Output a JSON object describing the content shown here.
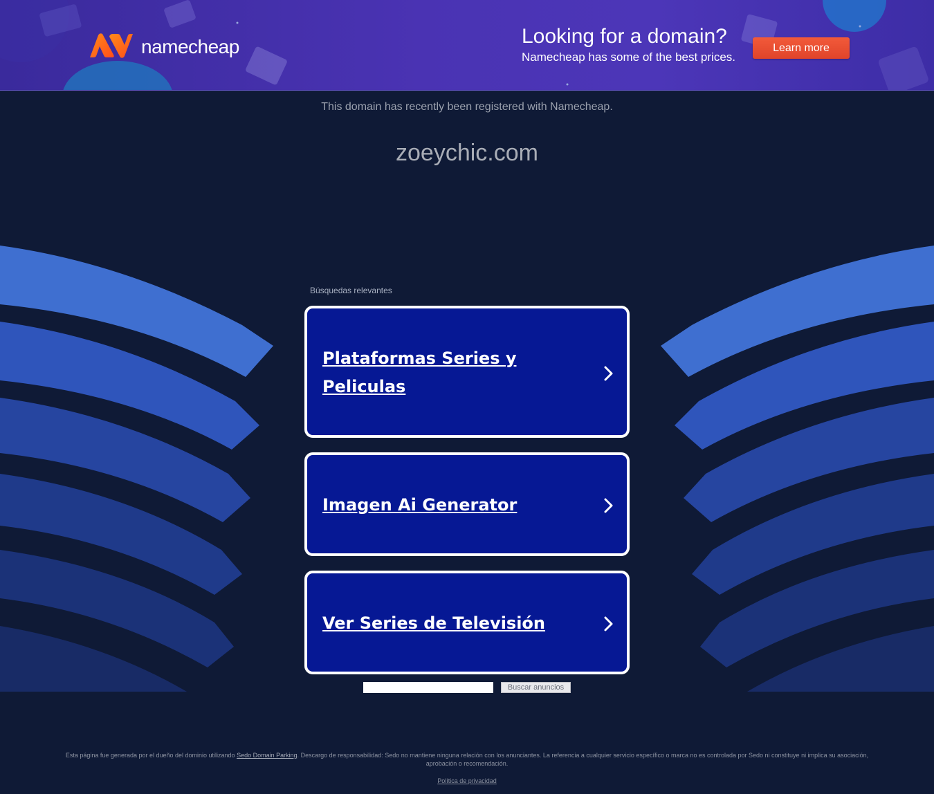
{
  "banner": {
    "brand": "namecheap",
    "headline": "Looking for a domain?",
    "subline": "Namecheap has some of the best prices.",
    "cta_label": "Learn more",
    "colors": {
      "brand_orange": "#ff6a1a",
      "cta_red": "#e8492e",
      "banner_purple": "#4a33b3"
    }
  },
  "header": {
    "registered_notice": "This domain has recently been registered with Namecheap.",
    "domain": "zoeychic.com"
  },
  "related": {
    "title": "Búsquedas relevantes",
    "items": [
      {
        "label": "Plataformas Series y Peliculas"
      },
      {
        "label": "Imagen Ai Generator"
      },
      {
        "label": "Ver Series de Televisión"
      }
    ]
  },
  "search": {
    "input_value": "",
    "button_label": "Buscar anuncios"
  },
  "footer": {
    "disclaimer_before": "Esta página fue generada por el dueño del dominio utilizando ",
    "disclaimer_link": "Sedo Domain Parking",
    "disclaimer_after": ". Descargo de responsabilidad: Sedo no mantiene ninguna relación con los anunciantes. La referencia a cualquier servicio específico o marca no es controlada por Sedo ni constituye ni implica su asociación, aprobación o recomendación.",
    "privacy_label": "Política de privacidad"
  },
  "colors": {
    "page_background": "#0f1a36",
    "card_background": "#061894",
    "card_border": "#ffffff"
  }
}
